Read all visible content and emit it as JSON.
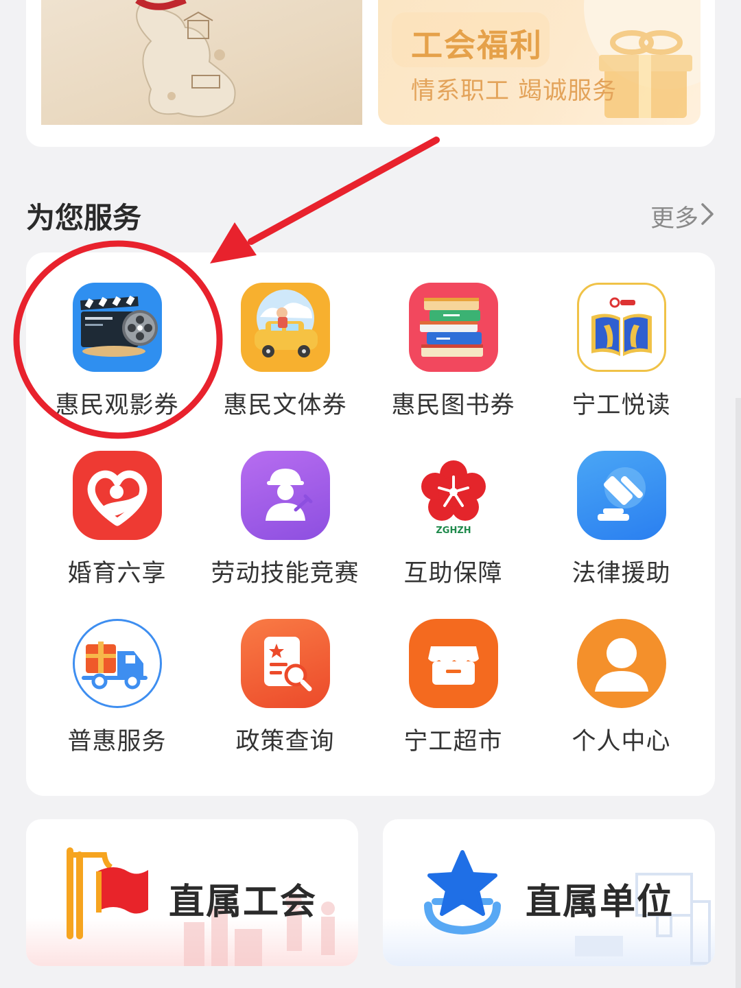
{
  "banner": {
    "title": "工会福利",
    "subtitle": "情系职工 竭诚服务"
  },
  "section": {
    "title": "为您服务",
    "more_label": "更多"
  },
  "services": [
    {
      "label": "惠民观影券",
      "icon": "film-reel-icon"
    },
    {
      "label": "惠民文体券",
      "icon": "travel-car-icon"
    },
    {
      "label": "惠民图书券",
      "icon": "books-stack-icon"
    },
    {
      "label": "宁工悦读",
      "icon": "open-book-icon"
    },
    {
      "label": "婚育六享",
      "icon": "heart-hand-icon"
    },
    {
      "label": "劳动技能竞赛",
      "icon": "worker-icon"
    },
    {
      "label": "互助保障",
      "icon": "plum-flower-icon",
      "badge": "ZGHZH"
    },
    {
      "label": "法律援助",
      "icon": "gavel-icon"
    },
    {
      "label": "普惠服务",
      "icon": "delivery-truck-icon"
    },
    {
      "label": "政策查询",
      "icon": "document-search-icon"
    },
    {
      "label": "宁工超市",
      "icon": "store-icon"
    },
    {
      "label": "个人中心",
      "icon": "user-icon"
    }
  ],
  "bottom_cards": [
    {
      "label": "直属工会",
      "icon": "flag-icon"
    },
    {
      "label": "直属单位",
      "icon": "star-badge-icon"
    }
  ],
  "colors": {
    "annotation": "#e8222d",
    "banner_text": "#e5a14a"
  }
}
